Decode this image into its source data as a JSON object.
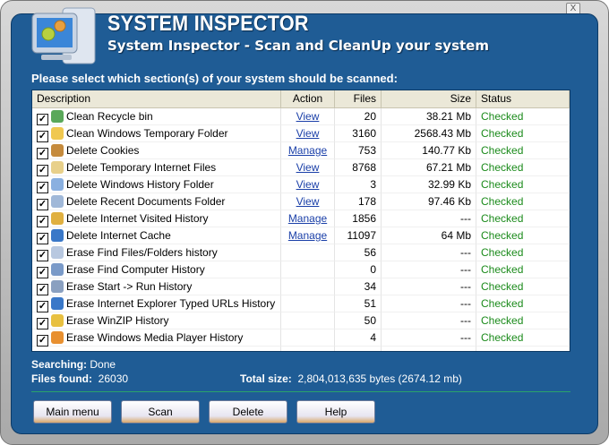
{
  "header": {
    "title": "SYSTEM INSPECTOR",
    "subtitle": "System Inspector - Scan and CleanUp your system",
    "close": "X"
  },
  "prompt": "Please select which section(s) of your system should be scanned:",
  "columns": [
    "Description",
    "Action",
    "Files",
    "Size",
    "Status"
  ],
  "rows": [
    {
      "desc": "Clean Recycle bin",
      "action": "View",
      "files": "20",
      "size": "38.21 Mb",
      "status": "Checked",
      "icon": "#5aa85a"
    },
    {
      "desc": "Clean Windows Temporary Folder",
      "action": "View",
      "files": "3160",
      "size": "2568.43 Mb",
      "status": "Checked",
      "icon": "#f0c850"
    },
    {
      "desc": "Delete Cookies",
      "action": "Manage",
      "files": "753",
      "size": "140.77 Kb",
      "status": "Checked",
      "icon": "#c58a3c"
    },
    {
      "desc": "Delete Temporary Internet Files",
      "action": "View",
      "files": "8768",
      "size": "67.21 Mb",
      "status": "Checked",
      "icon": "#e8d08a"
    },
    {
      "desc": "Delete Windows History Folder",
      "action": "View",
      "files": "3",
      "size": "32.99 Kb",
      "status": "Checked",
      "icon": "#8ab0e0"
    },
    {
      "desc": "Delete Recent Documents Folder",
      "action": "View",
      "files": "178",
      "size": "97.46 Kb",
      "status": "Checked",
      "icon": "#a0b8d8"
    },
    {
      "desc": "Delete Internet Visited History",
      "action": "Manage",
      "files": "1856",
      "size": "---",
      "status": "Checked",
      "icon": "#e0b040"
    },
    {
      "desc": "Delete Internet Cache",
      "action": "Manage",
      "files": "11097",
      "size": "64 Mb",
      "status": "Checked",
      "icon": "#3a78c8"
    },
    {
      "desc": "Erase Find Files/Folders history",
      "action": "",
      "files": "56",
      "size": "---",
      "status": "Checked",
      "icon": "#b8c8e0"
    },
    {
      "desc": "Erase Find Computer History",
      "action": "",
      "files": "0",
      "size": "---",
      "status": "Checked",
      "icon": "#7a9ac8"
    },
    {
      "desc": "Erase Start -> Run History",
      "action": "",
      "files": "34",
      "size": "---",
      "status": "Checked",
      "icon": "#8aa0c0"
    },
    {
      "desc": "Erase Internet Explorer Typed URLs History",
      "action": "",
      "files": "51",
      "size": "---",
      "status": "Checked",
      "icon": "#3a78c8"
    },
    {
      "desc": "Erase WinZIP History",
      "action": "",
      "files": "50",
      "size": "---",
      "status": "Checked",
      "icon": "#e8c040"
    },
    {
      "desc": "Erase Windows Media Player History",
      "action": "",
      "files": "4",
      "size": "---",
      "status": "Checked",
      "icon": "#e89030"
    },
    {
      "desc": "",
      "action": "",
      "files": "",
      "size": "",
      "status": "",
      "icon": "#fff"
    }
  ],
  "status": {
    "searching_label": "Searching:",
    "searching_value": "Done",
    "files_label": "Files found:",
    "files_value": "26030",
    "total_label": "Total size:",
    "total_value": "2,804,013,635 bytes (2674.12 mb)"
  },
  "buttons": {
    "main_menu": "Main menu",
    "scan": "Scan",
    "delete": "Delete",
    "help": "Help"
  }
}
